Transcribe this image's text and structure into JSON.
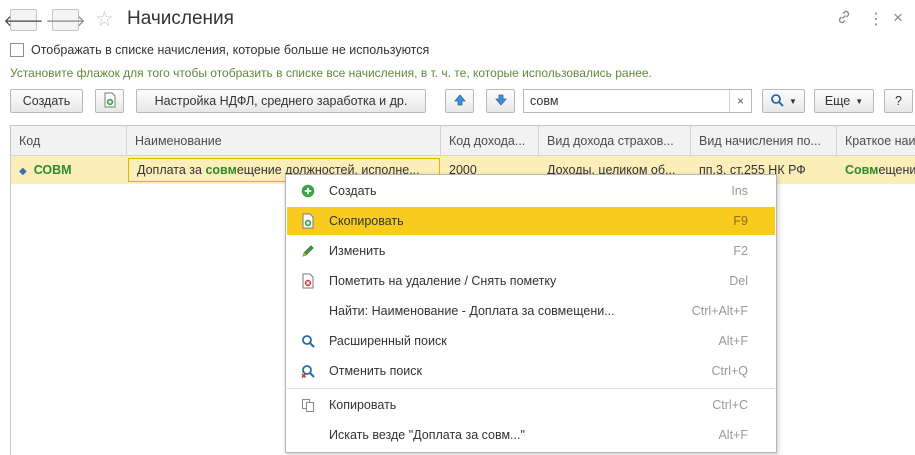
{
  "window": {
    "title": "Начисления"
  },
  "filter": {
    "show_unused_label": "Отображать в списке начисления, которые больше не используются",
    "hint": "Установите флажок для того чтобы отобразить в списке все начисления, в т. ч. те, которые использовались ранее."
  },
  "toolbar": {
    "create_label": "Создать",
    "ndfl_settings_label": "Настройка НДФЛ, среднего заработка и др.",
    "search_value": "совм",
    "search_clear": "×",
    "more_label": "Еще",
    "help_label": "?"
  },
  "grid": {
    "columns": [
      "Код",
      "Наименование",
      "Код дохода...",
      "Вид дохода страхов...",
      "Вид начисления по...",
      "Краткое наи"
    ],
    "row": {
      "code": "СОВМ",
      "name_before": "Доплата за ",
      "name_match": "совм",
      "name_after": "ещение должностей, исполне...",
      "income_code": "2000",
      "insurance_income": "Доходы, целиком об...",
      "accrual_type": "пп.3, ст.255 НК РФ",
      "short_match": "Совм",
      "short_after": "ещени..."
    }
  },
  "context_menu": {
    "items": [
      {
        "label": "Создать",
        "shortcut": "Ins",
        "icon": "plus-circle-icon"
      },
      {
        "label": "Скопировать",
        "shortcut": "F9",
        "icon": "copy-doc-icon"
      },
      {
        "label": "Изменить",
        "shortcut": "F2",
        "icon": "pencil-icon"
      },
      {
        "label": "Пометить на удаление / Снять пометку",
        "shortcut": "Del",
        "icon": "delete-mark-icon"
      },
      {
        "label": "Найти: Наименование - Доплата за совмещени...",
        "shortcut": "Ctrl+Alt+F",
        "icon": ""
      },
      {
        "label": "Расширенный поиск",
        "shortcut": "Alt+F",
        "icon": "advanced-search-icon"
      },
      {
        "label": "Отменить поиск",
        "shortcut": "Ctrl+Q",
        "icon": "cancel-search-icon"
      },
      {
        "label": "Копировать",
        "shortcut": "Ctrl+C",
        "icon": "clipboard-copy-icon"
      },
      {
        "label": "Искать везде \"Доплата за совм...\"",
        "shortcut": "Alt+F",
        "icon": ""
      }
    ],
    "highlighted_index": 1
  },
  "colors": {
    "accent_yellow": "#f8cb1f",
    "row_highlight": "#fbeeb9",
    "match_green": "#2e8b2e",
    "hint_green": "#5d8a3a"
  }
}
